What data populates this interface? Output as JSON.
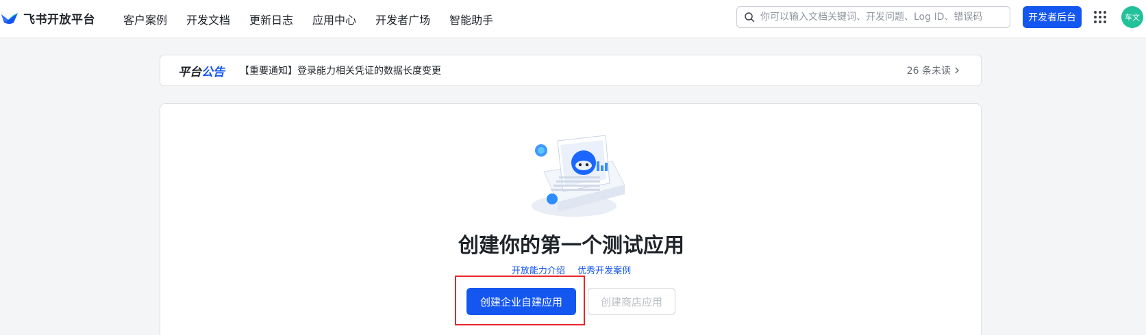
{
  "brand": {
    "name": "飞书开放平台"
  },
  "nav": {
    "items": [
      "客户案例",
      "开发文档",
      "更新日志",
      "应用中心",
      "开发者广场",
      "智能助手"
    ]
  },
  "search": {
    "placeholder": "你可以输入文档关键词、开发问题、Log ID、错误码",
    "value": ""
  },
  "header": {
    "console_label": "开发者后台",
    "avatar_text": "车文"
  },
  "notice": {
    "tag_part1": "平台",
    "tag_part2": "公告",
    "text": "【重要通知】登录能力相关凭证的数据长度变更",
    "unread": "26 条未读"
  },
  "main": {
    "headline": "创建你的第一个测试应用",
    "links": [
      "开放能力介绍",
      "优秀开发案例"
    ],
    "primary_button": "创建企业自建应用",
    "secondary_button": "创建商店应用"
  },
  "colors": {
    "accent": "#1456f0",
    "highlight": "#e8262a",
    "avatar": "#22c19a"
  }
}
